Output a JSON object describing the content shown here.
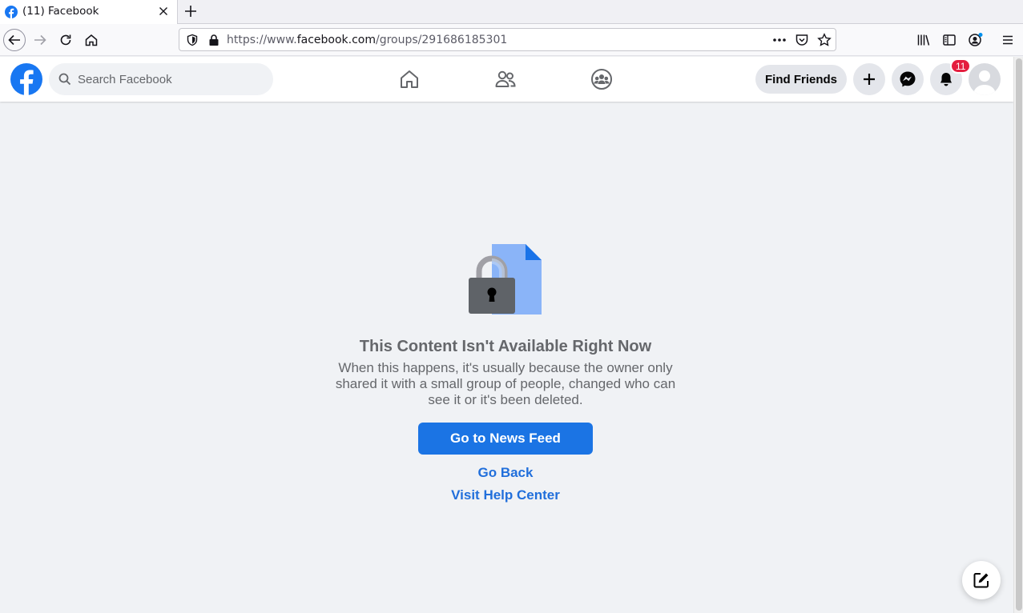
{
  "browser": {
    "tab": {
      "title": "(11) Facebook",
      "favicon": "facebook-favicon"
    },
    "url": {
      "prefix": "https://www.",
      "host": "facebook.com",
      "path": "/groups/291686185301"
    }
  },
  "header": {
    "search_placeholder": "Search Facebook",
    "find_friends_label": "Find Friends",
    "notification_count": "11",
    "nav_icons": [
      "home-icon",
      "friends-icon",
      "groups-icon"
    ]
  },
  "content": {
    "title": "This Content Isn't Available Right Now",
    "body": "When this happens, it's usually because the owner only shared it with a small group of people, changed who can see it or it's been deleted.",
    "primary_button": "Go to News Feed",
    "go_back": "Go Back",
    "help_center": "Visit Help Center"
  },
  "colors": {
    "brand": "#1877f2",
    "primary_button": "#1b74e4",
    "link": "#216fdb",
    "badge": "#e41e3f"
  }
}
